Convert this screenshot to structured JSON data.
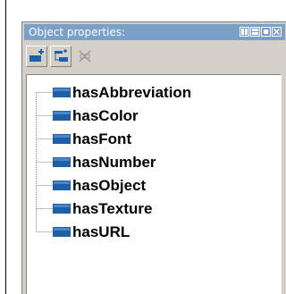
{
  "panel": {
    "title": "Object properties:",
    "title_bar_color": "#7aa0c8"
  },
  "toolbar": {
    "buttons": [
      {
        "icon": "add-property-icon",
        "enabled": true
      },
      {
        "icon": "add-subproperty-icon",
        "enabled": true
      },
      {
        "icon": "delete-property-icon",
        "enabled": false
      }
    ]
  },
  "tree": {
    "items": [
      {
        "label": "hasAbbreviation"
      },
      {
        "label": "hasColor"
      },
      {
        "label": "hasFont"
      },
      {
        "label": "hasNumber"
      },
      {
        "label": "hasObject"
      },
      {
        "label": "hasTexture"
      },
      {
        "label": "hasURL"
      }
    ],
    "icon_color": "#1e5fa8"
  }
}
